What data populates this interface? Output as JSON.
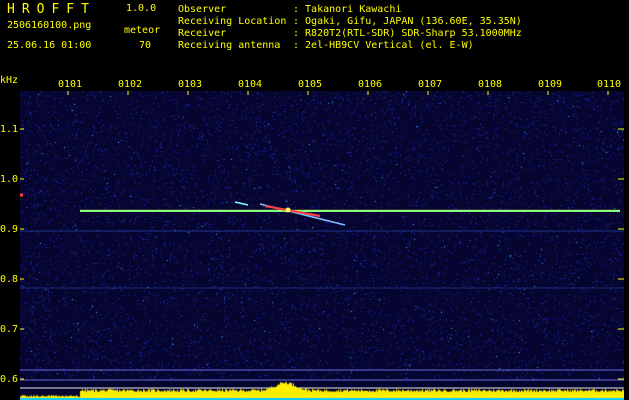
{
  "header": {
    "app_name": "HROFFT",
    "version": "1.0.0",
    "filename": "2506160100.png",
    "datetime": "25.06.16 01:00",
    "meteor_label": "meteor",
    "meteor_count": "70",
    "info": [
      {
        "key": "Observer",
        "value": ": Takanori Kawachi"
      },
      {
        "key": "Receiving Location",
        "value": ": Ogaki, Gifu, JAPAN (136.60E, 35.35N)"
      },
      {
        "key": "Receiver",
        "value": ": R820T2(RTL-SDR) SDR-Sharp 53.1000MHz"
      },
      {
        "key": "Receiving antenna",
        "value": ": 2el-HB9CV Vertical (el. E-W)"
      }
    ]
  },
  "axes": {
    "y_unit": "kHz",
    "y_ticks": [
      "1.1",
      "1.0",
      "0.9",
      "0.8",
      "0.7",
      "0.6"
    ],
    "x_ticks": [
      "0101",
      "0102",
      "0103",
      "0104",
      "0105",
      "0106",
      "0107",
      "0108",
      "0109",
      "0110"
    ]
  },
  "colors": {
    "text": "#ffff00",
    "background": "#000000",
    "waterfall": "#050530",
    "carrier": "#7fff7f",
    "level_bar": "#ffee00",
    "noise_floor": "#00ccff"
  }
}
